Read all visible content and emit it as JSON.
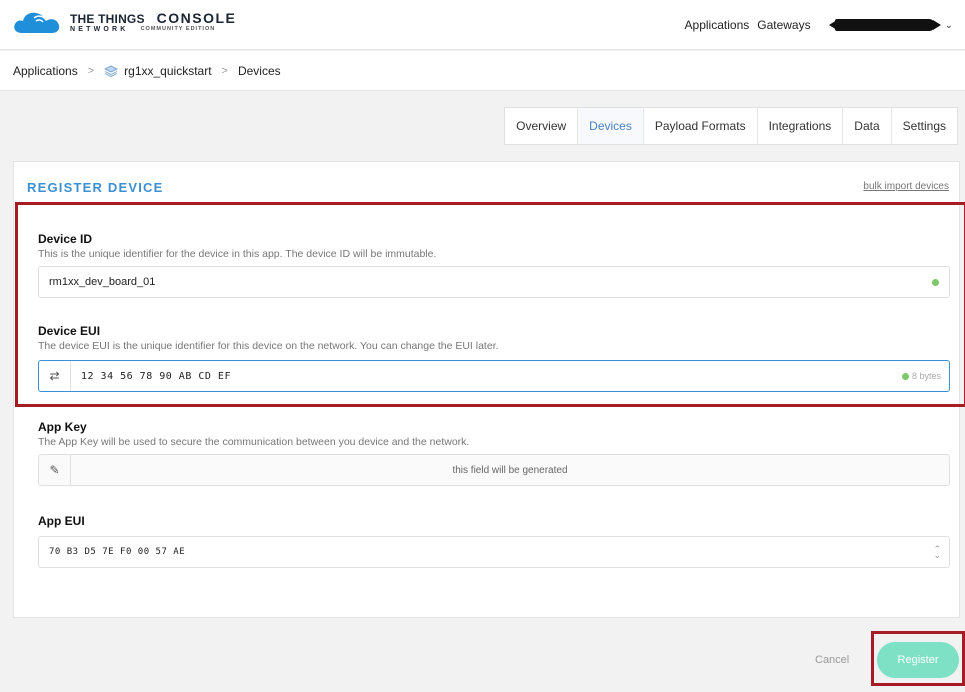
{
  "header": {
    "logo_ttn": "THE THINGS",
    "logo_network": "NETWORK",
    "logo_console": "CONSOLE",
    "logo_edition": "COMMUNITY EDITION",
    "nav": [
      "Applications",
      "Gateways"
    ]
  },
  "breadcrumb": {
    "items": [
      "Applications",
      "rg1xx_quickstart",
      "Devices"
    ]
  },
  "tabs": [
    {
      "label": "Overview",
      "active": false
    },
    {
      "label": "Devices",
      "active": true
    },
    {
      "label": "Payload Formats",
      "active": false
    },
    {
      "label": "Integrations",
      "active": false
    },
    {
      "label": "Data",
      "active": false
    },
    {
      "label": "Settings",
      "active": false
    }
  ],
  "form": {
    "title": "REGISTER DEVICE",
    "bulk_link": "bulk import devices",
    "device_id": {
      "label": "Device ID",
      "desc": "This is the unique identifier for the device in this app. The device ID will be immutable.",
      "value": "rm1xx_dev_board_01"
    },
    "device_eui": {
      "label": "Device EUI",
      "desc": "The device EUI is the unique identifier for this device on the network. You can change the EUI later.",
      "value": "12 34 56 78 90 AB CD EF",
      "bytes": "8 bytes"
    },
    "app_key": {
      "label": "App Key",
      "desc": "The App Key will be used to secure the communication between you device and the network.",
      "placeholder": "this field will be generated"
    },
    "app_eui": {
      "label": "App EUI",
      "value": "70 B3 D5 7E F0 00 57 AE"
    }
  },
  "actions": {
    "cancel": "Cancel",
    "register": "Register"
  },
  "colors": {
    "accent": "#3d8fd3",
    "register": "#7ee0c4",
    "highlight": "#a51c24",
    "ok": "#7dc86a"
  }
}
